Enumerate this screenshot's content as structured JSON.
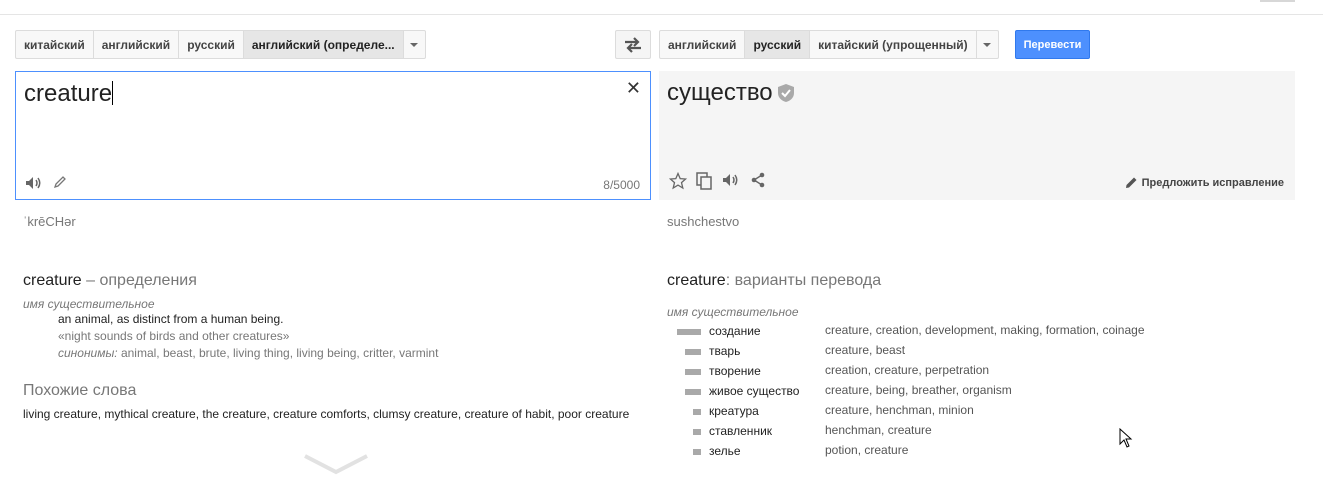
{
  "source_langs": {
    "tabs": [
      "китайский",
      "английский",
      "русский",
      "английский (определе..."
    ],
    "selected": 3
  },
  "target_langs": {
    "tabs": [
      "английский",
      "русский",
      "китайский (упрощенный)"
    ],
    "selected": 1
  },
  "translate_button": "Перевести",
  "source": {
    "text": "creature",
    "char_count": "8/5000",
    "transliteration": "ˈkrēCHər"
  },
  "target": {
    "text": "существо",
    "suggest_label": "Предложить исправление",
    "transliteration": "sushchestvo"
  },
  "definitions": {
    "word": "creature",
    "suffix": " – определения",
    "pos": "имя существительное",
    "definition": "an animal, as distinct from a human being.",
    "example": "«night sounds of birds and other creatures»",
    "synonyms_label": "синонимы:",
    "synonyms": " animal, beast, brute, living thing, living being, critter, varmint"
  },
  "related": {
    "heading": "Похожие слова",
    "words": "living creature, mythical creature, the creature, creature comforts, clumsy creature, creature of habit, poor creature"
  },
  "translations": {
    "word": "creature",
    "suffix": ": варианты перевода",
    "pos": "имя существительное",
    "rows": [
      {
        "term": "создание",
        "synonyms": "creature, creation, development, making, formation, coinage",
        "freq": 1.0
      },
      {
        "term": "тварь",
        "synonyms": "creature, beast",
        "freq": 0.66
      },
      {
        "term": "творение",
        "synonyms": "creation, creature, perpetration",
        "freq": 0.66
      },
      {
        "term": "живое существо",
        "synonyms": "creature, being, breather, organism",
        "freq": 0.66
      },
      {
        "term": "креатура",
        "synonyms": "creature, henchman, minion",
        "freq": 0.33
      },
      {
        "term": "ставленник",
        "synonyms": "henchman, creature",
        "freq": 0.33
      },
      {
        "term": "зелье",
        "synonyms": "potion, creature",
        "freq": 0.33
      }
    ]
  }
}
